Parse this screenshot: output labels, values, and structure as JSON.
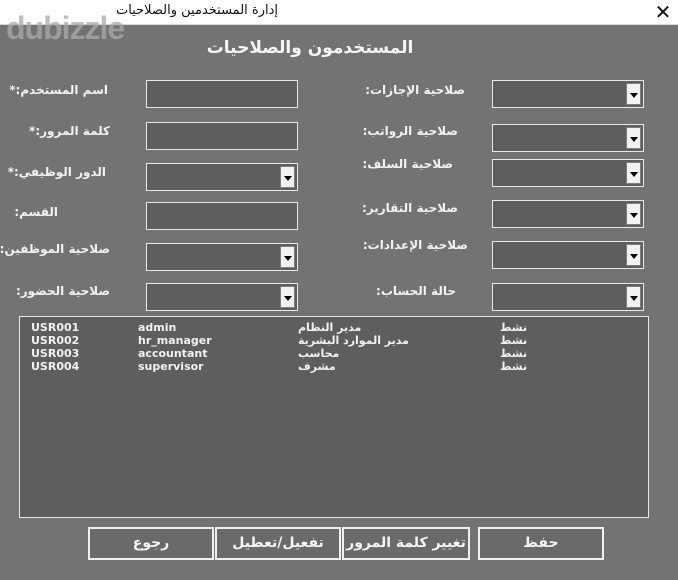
{
  "window": {
    "title": "إدارة المستخدمين والصلاحيات",
    "close_glyph": "✕",
    "watermark": "dubizzle"
  },
  "form": {
    "title": "المستخدمون والصلاحيات"
  },
  "left_fields": {
    "username": "اسم المستخدم:*",
    "password": "كلمة المرور:*",
    "job_role": "الدور الوظيفي:*",
    "department": "القسم:",
    "employees_perm": "صلاحية الموظفين:",
    "attendance_perm": "صلاحية الحضور:"
  },
  "right_fields": {
    "leaves_perm": "صلاحية الإجازات:",
    "salaries_perm": "صلاحية الرواتب:",
    "advances_perm": "صلاحية السلف:",
    "reports_perm": "صلاحية التقارير:",
    "settings_perm": "صلاحية الإعدادات:",
    "account_status": "حالة الحساب:"
  },
  "users": [
    {
      "id": "USR001",
      "username": "admin",
      "role": "مدير النظام",
      "status": "نشط"
    },
    {
      "id": "USR002",
      "username": "hr_manager",
      "role": "مدير الموارد البشرية",
      "status": "نشط"
    },
    {
      "id": "USR003",
      "username": "accountant",
      "role": "محاسب",
      "status": "نشط"
    },
    {
      "id": "USR004",
      "username": "supervisor",
      "role": "مشرف",
      "status": "نشط"
    }
  ],
  "buttons": {
    "save": "حفظ",
    "change_password": "تغيير كلمة المرور",
    "toggle_active": "تفعيل/تعطيل",
    "back": "رجوع"
  },
  "icons": {
    "dropdown": "chevron-down-icon",
    "close": "close-icon"
  },
  "colors": {
    "background": "#737373",
    "field": "#5e5e5e",
    "text": "#f2f2f2"
  }
}
